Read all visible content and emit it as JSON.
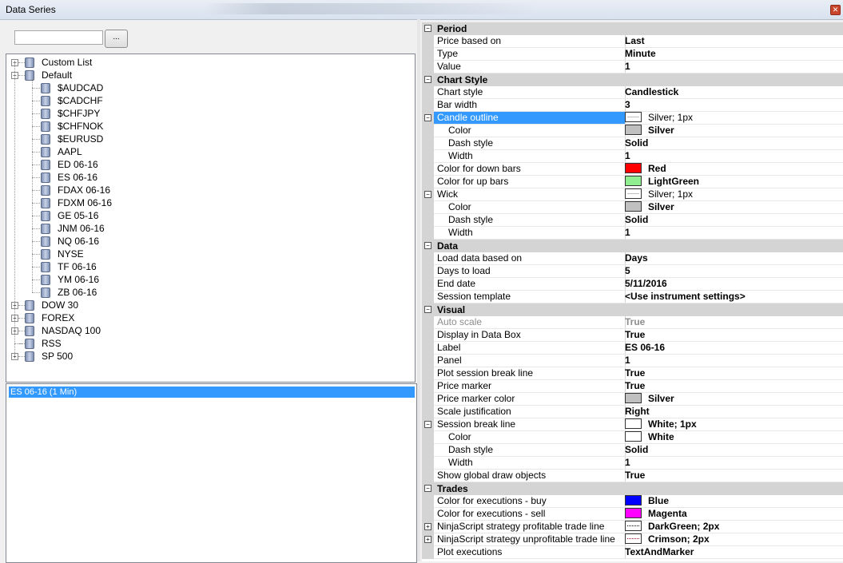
{
  "window": {
    "title": "Data Series"
  },
  "left": {
    "search": {
      "value": "",
      "placeholder": ""
    },
    "browse_label": "...",
    "tree": [
      {
        "label": "Custom List",
        "type": "group",
        "expanded": false
      },
      {
        "label": "Default",
        "type": "group",
        "expanded": true,
        "children": [
          "$AUDCAD",
          "$CADCHF",
          "$CHFJPY",
          "$CHFNOK",
          "$EURUSD",
          "AAPL",
          "ED 06-16",
          "ES 06-16",
          "FDAX 06-16",
          "FDXM 06-16",
          "GE 05-16",
          "JNM 06-16",
          "NQ 06-16",
          "NYSE",
          "TF 06-16",
          "YM 06-16",
          "ZB 06-16"
        ]
      },
      {
        "label": "DOW 30",
        "type": "group",
        "expanded": false
      },
      {
        "label": "FOREX",
        "type": "group",
        "expanded": false
      },
      {
        "label": "NASDAQ 100",
        "type": "group",
        "expanded": false
      },
      {
        "label": "RSS",
        "type": "item"
      },
      {
        "label": "SP 500",
        "type": "group",
        "expanded": false
      }
    ],
    "series": [
      "ES 06-16 (1 Min)"
    ]
  },
  "grid": [
    {
      "kind": "cat",
      "label": "Period"
    },
    {
      "kind": "prop",
      "name": "Price based on",
      "value": "Last"
    },
    {
      "kind": "prop",
      "name": "Type",
      "value": "Minute"
    },
    {
      "kind": "prop",
      "name": "Value",
      "value": "1"
    },
    {
      "kind": "cat",
      "label": "Chart Style"
    },
    {
      "kind": "prop",
      "name": "Chart style",
      "value": "Candlestick"
    },
    {
      "kind": "prop",
      "name": "Bar width",
      "value": "3"
    },
    {
      "kind": "prop",
      "name": "Candle outline",
      "value": "Silver; 1px",
      "selected": true,
      "toggle": "minus",
      "swatch": "line",
      "normal": true
    },
    {
      "kind": "prop",
      "name": "Color",
      "value": "Silver",
      "sub": true,
      "swatch": "#c0c0c0"
    },
    {
      "kind": "prop",
      "name": "Dash style",
      "value": "Solid",
      "sub": true
    },
    {
      "kind": "prop",
      "name": "Width",
      "value": "1",
      "sub": true
    },
    {
      "kind": "prop",
      "name": "Color for down bars",
      "value": "Red",
      "swatch": "#ff0000"
    },
    {
      "kind": "prop",
      "name": "Color for up bars",
      "value": "LightGreen",
      "swatch": "#90ee90"
    },
    {
      "kind": "prop",
      "name": "Wick",
      "value": "Silver; 1px",
      "toggle": "minus",
      "swatch": "line",
      "normal": true
    },
    {
      "kind": "prop",
      "name": "Color",
      "value": "Silver",
      "sub": true,
      "swatch": "#c0c0c0"
    },
    {
      "kind": "prop",
      "name": "Dash style",
      "value": "Solid",
      "sub": true
    },
    {
      "kind": "prop",
      "name": "Width",
      "value": "1",
      "sub": true
    },
    {
      "kind": "cat",
      "label": "Data"
    },
    {
      "kind": "prop",
      "name": "Load data based on",
      "value": "Days"
    },
    {
      "kind": "prop",
      "name": "Days to load",
      "value": "5"
    },
    {
      "kind": "prop",
      "name": "End date",
      "value": "5/11/2016"
    },
    {
      "kind": "prop",
      "name": "Session template",
      "value": "<Use instrument settings>"
    },
    {
      "kind": "cat",
      "label": "Visual"
    },
    {
      "kind": "prop",
      "name": "Auto scale",
      "value": "True",
      "dim": true
    },
    {
      "kind": "prop",
      "name": "Display in Data Box",
      "value": "True"
    },
    {
      "kind": "prop",
      "name": "Label",
      "value": "ES 06-16"
    },
    {
      "kind": "prop",
      "name": "Panel",
      "value": "1"
    },
    {
      "kind": "prop",
      "name": "Plot session break line",
      "value": "True"
    },
    {
      "kind": "prop",
      "name": "Price marker",
      "value": "True"
    },
    {
      "kind": "prop",
      "name": "Price marker color",
      "value": "Silver",
      "swatch": "#c0c0c0"
    },
    {
      "kind": "prop",
      "name": "Scale justification",
      "value": "Right"
    },
    {
      "kind": "prop",
      "name": "Session break line",
      "value": "White; 1px",
      "toggle": "minus",
      "swatch": "#ffffff"
    },
    {
      "kind": "prop",
      "name": "Color",
      "value": "White",
      "sub": true,
      "swatch": "#ffffff"
    },
    {
      "kind": "prop",
      "name": "Dash style",
      "value": "Solid",
      "sub": true
    },
    {
      "kind": "prop",
      "name": "Width",
      "value": "1",
      "sub": true
    },
    {
      "kind": "prop",
      "name": "Show global draw objects",
      "value": "True"
    },
    {
      "kind": "cat",
      "label": "Trades"
    },
    {
      "kind": "prop",
      "name": "Color for executions - buy",
      "value": "Blue",
      "swatch": "#0000ff"
    },
    {
      "kind": "prop",
      "name": "Color for executions - sell",
      "value": "Magenta",
      "swatch": "#ff00ff"
    },
    {
      "kind": "prop",
      "name": "NinjaScript strategy profitable trade line",
      "value": "DarkGreen; 2px",
      "toggle": "plus",
      "swatch": "dots"
    },
    {
      "kind": "prop",
      "name": "NinjaScript strategy unprofitable trade line",
      "value": "Crimson; 2px",
      "toggle": "plus",
      "swatch": "dots-crimson"
    },
    {
      "kind": "prop",
      "name": "Plot executions",
      "value": "TextAndMarker"
    }
  ]
}
